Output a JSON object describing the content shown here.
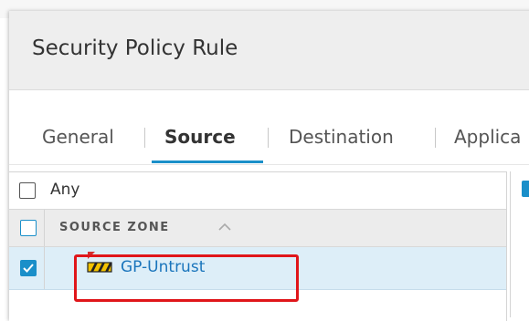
{
  "dialog": {
    "title": "Security Policy Rule"
  },
  "tabs": [
    {
      "label": "General",
      "active": false
    },
    {
      "label": "Source",
      "active": true
    },
    {
      "label": "Destination",
      "active": false
    },
    {
      "label": "Applica",
      "active": false
    }
  ],
  "source_zone": {
    "any_label": "Any",
    "any_checked": false,
    "column_header": "SOURCE ZONE",
    "rows": [
      {
        "name": "GP-Untrust",
        "checked": true,
        "icon": "zone-icon"
      }
    ]
  },
  "colors": {
    "accent": "#1a8fc9",
    "link": "#1a75bc",
    "selected_row": "#ddeef8",
    "highlight": "#e0161a",
    "header_bg": "#eeeeee"
  }
}
